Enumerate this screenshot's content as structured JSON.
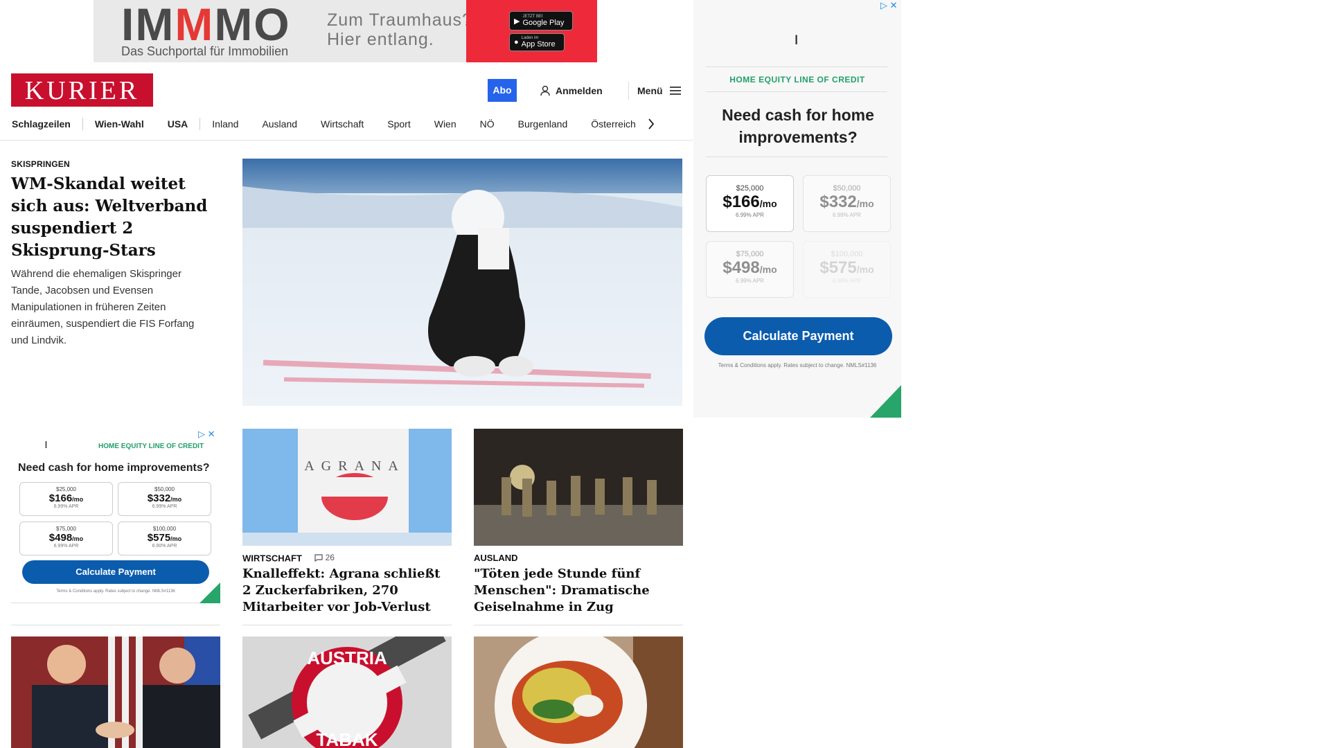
{
  "top_ad": {
    "brand_pre": "IM",
    "brand_mid": "M",
    "brand_post": "MO",
    "subtitle": "Das Suchportal für Immobilien",
    "tagline_1": "Zum Traumhaus?",
    "tagline_2": "Hier entlang.",
    "google_small": "JETZT BEI",
    "google_label": "Google Play",
    "apple_small": "Laden im",
    "apple_label": "App Store"
  },
  "header": {
    "logo": "KURIER",
    "abo": "Abo",
    "login": "Anmelden",
    "menu": "Menü"
  },
  "nav": {
    "items": [
      "Schlagzeilen",
      "Wien-Wahl",
      "USA",
      "Inland",
      "Ausland",
      "Wirtschaft",
      "Sport",
      "Wien",
      "NÖ",
      "Burgenland",
      "Österreich"
    ]
  },
  "lead": {
    "kicker": "SKISPRINGEN",
    "title": "WM-Skandal weitet sich aus: Weltverband suspendiert 2 Skisprung-Stars",
    "teaser": "Während die ehemaligen Skispringer Tande, Jacobsen und Evensen Manipulationen in früheren Zeiten einräumen, suspendiert die FIS Forfang und Lindvik."
  },
  "side_ad": {
    "category": "HOME EQUITY LINE OF CREDIT",
    "question": "Need cash for home improvements?",
    "options": [
      {
        "amount": "$25,000",
        "payment": "$166",
        "unit": "/mo",
        "apr": "6.99% APR"
      },
      {
        "amount": "$50,000",
        "payment": "$332",
        "unit": "/mo",
        "apr": "6.99% APR"
      },
      {
        "amount": "$75,000",
        "payment": "$498",
        "unit": "/mo",
        "apr": "6.99% APR"
      },
      {
        "amount": "$100,000",
        "payment": "$575",
        "unit": "/mo",
        "apr": "6.90% APR"
      }
    ],
    "cta": "Calculate Payment",
    "terms": "Terms & Conditions apply. Rates subject to change. NMLS#1136"
  },
  "inline_ad": {
    "category": "HOME EQUITY LINE OF CREDIT",
    "question": "Need cash for home improvements?",
    "options": [
      {
        "amount": "$25,000",
        "payment": "$166",
        "unit": "/mo",
        "apr": "6.99% APR"
      },
      {
        "amount": "$50,000",
        "payment": "$332",
        "unit": "/mo",
        "apr": "6.99% APR"
      },
      {
        "amount": "$75,000",
        "payment": "$498",
        "unit": "/mo",
        "apr": "6.99% APR"
      },
      {
        "amount": "$100,000",
        "payment": "$575",
        "unit": "/mo",
        "apr": "6.90% APR"
      }
    ],
    "cta": "Calculate Payment",
    "terms": "Terms & Conditions apply. Rates subject to change. NMLS#1136"
  },
  "cards": [
    {
      "kicker": "WIRTSCHAFT",
      "comments": "26",
      "title": "Knalleffekt: Agrana schließt 2 Zuckerfabriken, 270 Mitarbeiter vor Job-Verlust"
    },
    {
      "kicker": "AUSLAND",
      "title": "\"Töten jede Stunde fünf Menschen\": Dramatische Geiselnahme in Zug"
    }
  ],
  "images": {
    "agrana_text": "AGRANA",
    "tabak_top": "AUSTRIA",
    "tabak_bottom": "TABAK"
  },
  "colors": {
    "kurier_red": "#c8102e",
    "abo_blue": "#2563eb",
    "ad_blue": "#0b5cad",
    "ad_green": "#22a06b"
  }
}
